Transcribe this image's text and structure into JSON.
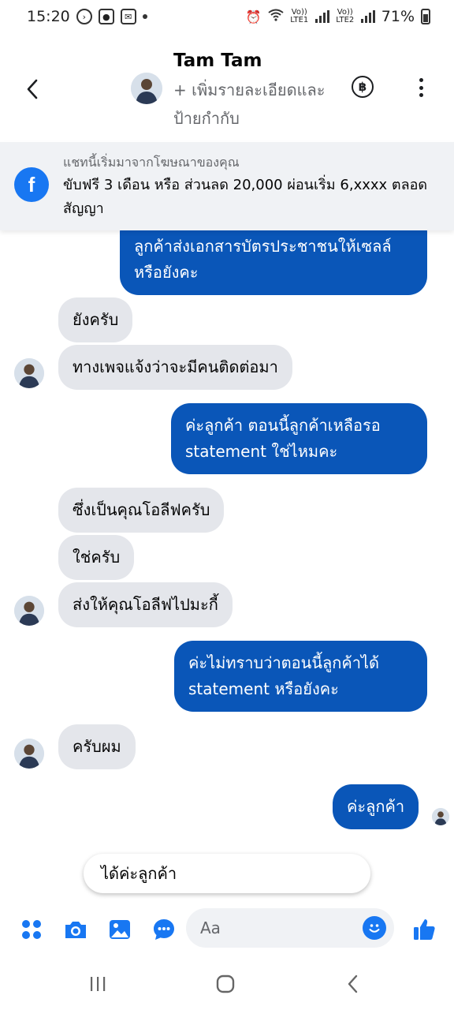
{
  "status_bar": {
    "time": "15:20",
    "sim1": "Vo)) LTE1",
    "sim2": "Vo)) LTE2",
    "battery": "71%"
  },
  "header": {
    "name": "Tam Tam",
    "subtitle": "+ เพิ่มรายละเอียดและป้ายกำกับ",
    "baht_symbol": "฿"
  },
  "ad_banner": {
    "title": "แชทนี้เริ่มมาจากโฆษณาของคุณ",
    "body": "ขับฟรี 3 เดือน หรือ ส่วนลด 20,000 ผ่อนเริ่ม 6,xxxx ตลอดสัญญา",
    "logo_letter": "f"
  },
  "messages": [
    {
      "side": "out",
      "text": "ลูกค้าส่งเอกสารบัตรประชาชนให้เซลล์หรือยังคะ"
    },
    {
      "side": "in",
      "text": "ยังครับ"
    },
    {
      "side": "in",
      "text": "ทางเพจแจ้งว่าจะมีคนติดต่อมา"
    },
    {
      "side": "out",
      "text": "ค่ะลูกค้า ตอนนี้ลูกค้าเหลือรอ statement ใช่ไหมคะ"
    },
    {
      "side": "in",
      "text": "ซึ่งเป็นคุณโอลีฟครับ"
    },
    {
      "side": "in",
      "text": "ใช่ครับ"
    },
    {
      "side": "in",
      "text": "ส่งให้คุณโอลีฟไปมะกี้"
    },
    {
      "side": "out",
      "text": "ค่ะไม่ทราบว่าตอนนี้ลูกค้าได้ statement หรือยังคะ"
    },
    {
      "side": "in",
      "text": "ครับผม"
    },
    {
      "side": "out",
      "text": "ค่ะลูกค้า"
    }
  ],
  "suggested_reply": "ได้ค่ะลูกค้า",
  "composer": {
    "placeholder": "Aa"
  },
  "colors": {
    "outgoing_bubble": "#0a56b8",
    "incoming_bubble": "#e4e6eb",
    "messenger_blue": "#1877f2",
    "banner_bg": "#f0f2f5"
  },
  "icons": [
    "back-arrow-icon",
    "baht-icon",
    "more-vertical-icon",
    "facebook-icon",
    "apps-icon",
    "camera-icon",
    "gallery-icon",
    "chat-bubble-icon",
    "emoji-icon",
    "thumbs-up-icon",
    "recent-apps-icon",
    "home-icon",
    "back-nav-icon"
  ]
}
